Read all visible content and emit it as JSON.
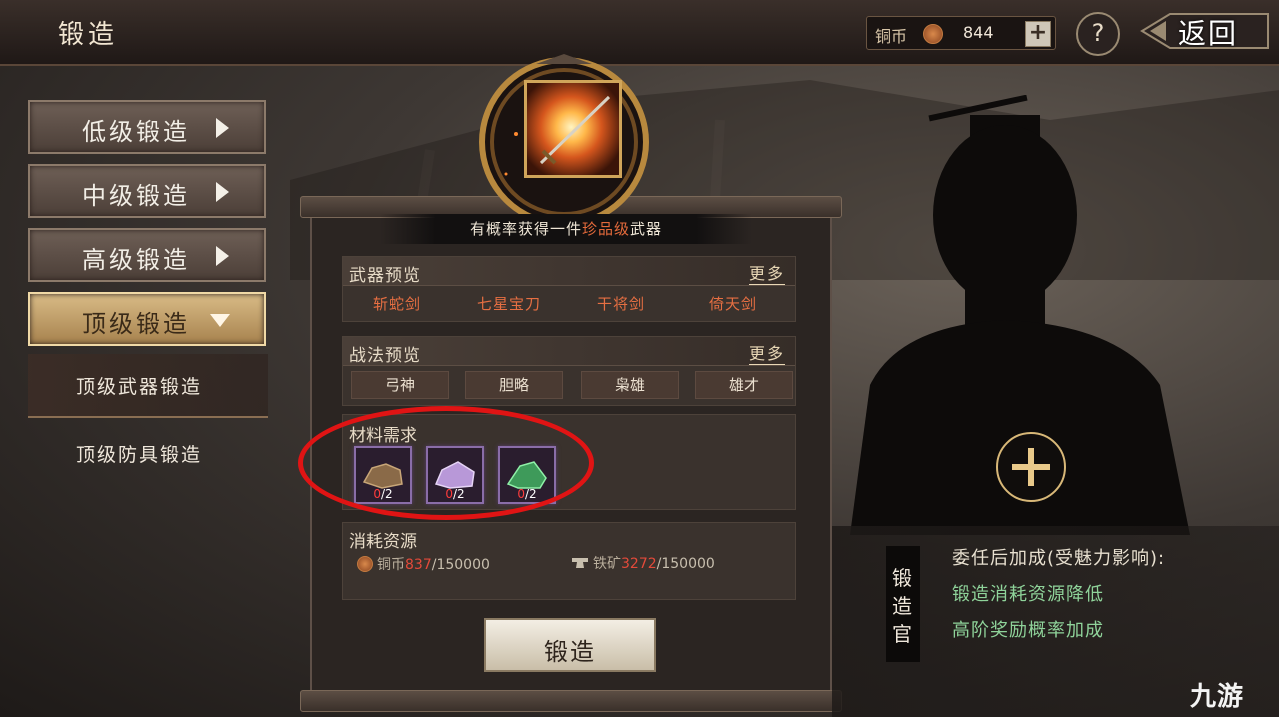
{
  "header": {
    "title": "锻造",
    "currency_label": "铜币",
    "currency_value": "844",
    "add_label": "+",
    "help_label": "?",
    "back_label": "返回"
  },
  "menu": {
    "items": [
      {
        "label": "低级锻造"
      },
      {
        "label": "中级锻造"
      },
      {
        "label": "高级锻造"
      },
      {
        "label": "顶级锻造"
      }
    ],
    "sub_items": [
      {
        "label": "顶级武器锻造"
      },
      {
        "label": "顶级防具锻造"
      }
    ]
  },
  "banner": {
    "prefix": "有概率获得一件",
    "highlight": "珍品级",
    "suffix": "武器"
  },
  "weapon_preview": {
    "title": "武器预览",
    "more": "更多",
    "items": [
      "斩蛇剑",
      "七星宝刀",
      "干将剑",
      "倚天剑"
    ]
  },
  "tactic_preview": {
    "title": "战法预览",
    "more": "更多",
    "items": [
      "弓神",
      "胆略",
      "枭雄",
      "雄才"
    ]
  },
  "materials": {
    "title": "材料需求",
    "items": [
      {
        "icon": "brown-ore-icon",
        "have": "0",
        "need": "/2"
      },
      {
        "icon": "purple-crystal-icon",
        "have": "0",
        "need": "/2"
      },
      {
        "icon": "green-jade-icon",
        "have": "0",
        "need": "/2"
      }
    ]
  },
  "resources": {
    "title": "消耗资源",
    "copper": {
      "label": "铜币",
      "have": "837",
      "need": "/150000"
    },
    "iron": {
      "label": "铁矿",
      "have": "3272",
      "need": "/150000"
    }
  },
  "forge_button": "锻造",
  "officer": {
    "tag": "锻造官",
    "bonus_title": "委任后加成(受魅力影响):",
    "bonuses": [
      "锻造消耗资源降低",
      "高阶奖励概率加成"
    ]
  },
  "watermark": "九游",
  "colors": {
    "accent_gold": "#d9bb86",
    "highlight_red": "#e46a3b",
    "bonus_green": "#8fd39a",
    "annotation_red": "#e01414"
  }
}
